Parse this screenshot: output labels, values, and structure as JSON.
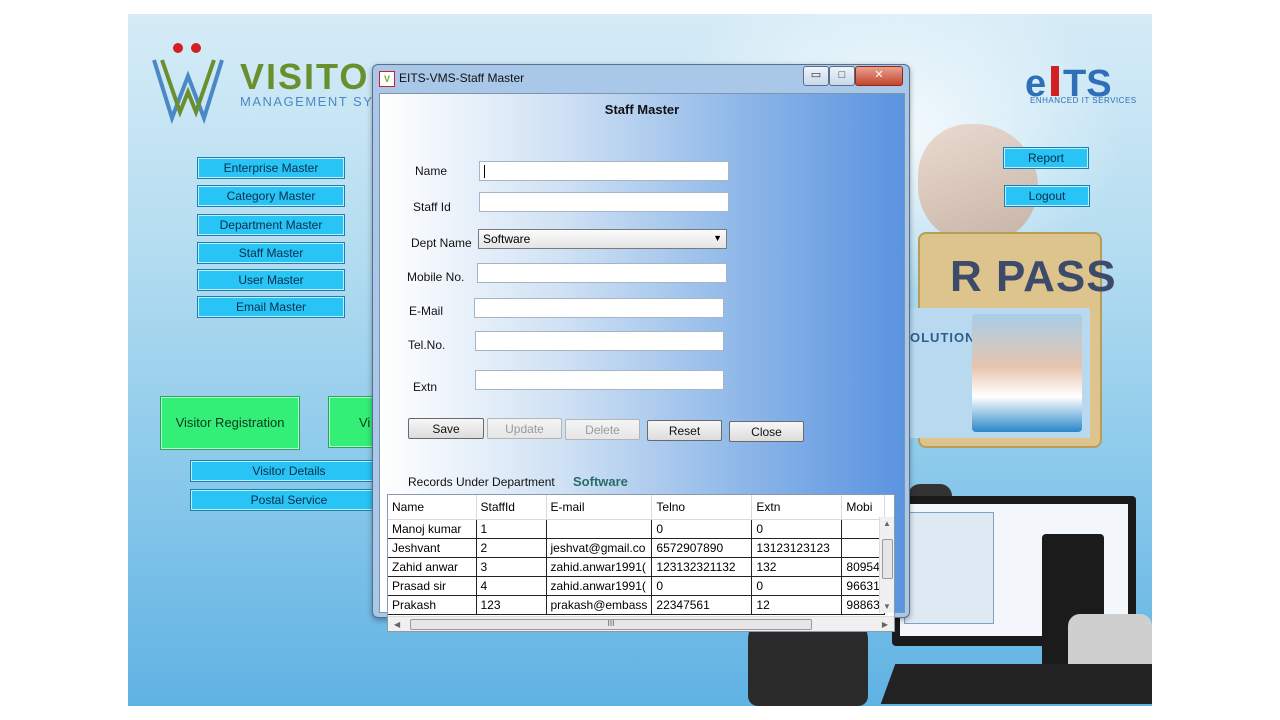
{
  "background": {
    "logo": {
      "title": "VISITO",
      "subtitle": "MANAGEMENT SYST"
    },
    "brand": {
      "name": "eiTS",
      "tagline": "ENHANCED IT SERVICES"
    },
    "pass_card": {
      "headline": "R PASS",
      "company": "OLUTIONS"
    },
    "menu_buttons": [
      "Enterprise Master",
      "Category Master",
      "Department Master",
      "Staff Master",
      "User Master",
      "Email Master"
    ],
    "green_buttons": [
      "Visitor Registration",
      "Vi"
    ],
    "lower_buttons": [
      "Visitor Details",
      "Postal Service"
    ],
    "right_buttons": [
      "Report",
      "Logout"
    ]
  },
  "dialog": {
    "title": "EITS-VMS-Staff Master",
    "heading": "Staff Master",
    "title_buttons": {
      "minimize": "▭",
      "maximize": "□",
      "close": "✕"
    },
    "fields": {
      "name": {
        "label": "Name",
        "value": ""
      },
      "staff_id": {
        "label": "Staff Id",
        "value": ""
      },
      "dept_name": {
        "label": "Dept Name",
        "value": "Software"
      },
      "mobile": {
        "label": "Mobile No.",
        "value": ""
      },
      "email": {
        "label": "E-Mail",
        "value": ""
      },
      "tel": {
        "label": "Tel.No.",
        "value": ""
      },
      "extn": {
        "label": "Extn",
        "value": ""
      }
    },
    "actions": {
      "save": "Save",
      "update": "Update",
      "delete": "Delete",
      "reset": "Reset",
      "close": "Close"
    },
    "records_label": "Records Under Department",
    "records_department": "Software",
    "grid": {
      "columns": [
        "Name",
        "StaffId",
        "E-mail",
        "Telno",
        "Extn",
        "Mobi"
      ],
      "rows": [
        [
          "Manoj kumar",
          "1",
          "",
          "0",
          "0",
          ""
        ],
        [
          "Jeshvant",
          "2",
          "jeshvat@gmail.co",
          "6572907890",
          "13123123123",
          ""
        ],
        [
          "Zahid anwar",
          "3",
          "zahid.anwar1991(",
          "123132321132",
          "132",
          "80954"
        ],
        [
          "Prasad sir",
          "4",
          "zahid.anwar1991(",
          "0",
          "0",
          "96631"
        ],
        [
          "Prakash",
          "123",
          "prakash@embass",
          "22347561",
          "12",
          "98863"
        ]
      ],
      "hscroll_grip": "III"
    }
  }
}
